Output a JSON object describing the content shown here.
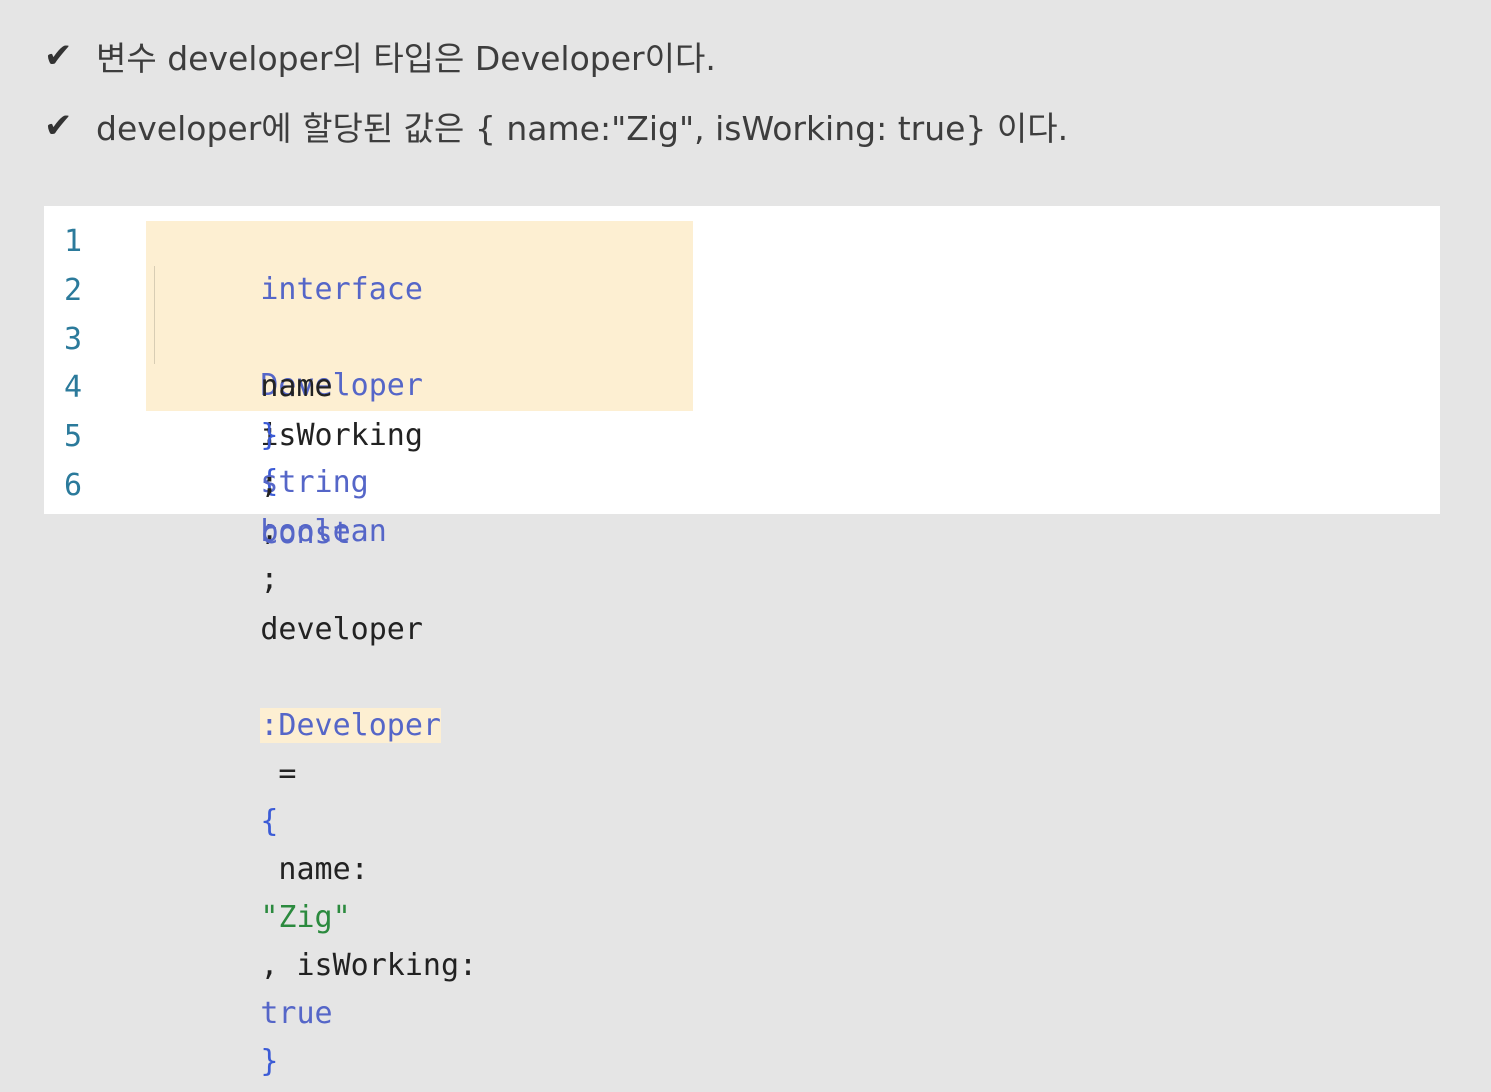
{
  "bullets": [
    {
      "check": "✔",
      "text": "변수 developer의 타입은 Developer이다."
    },
    {
      "check": "✔",
      "text": "developer에 할당된 값은 { name:\"Zig\", isWorking: true} 이다."
    }
  ],
  "code": {
    "line_numbers": [
      "1",
      "2",
      "3",
      "4",
      "5",
      "6"
    ],
    "line1": {
      "kw": "interface",
      "name": "Developer",
      "brace": "{"
    },
    "line2": {
      "indent": "    ",
      "prop": "name",
      "colon": ": ",
      "type": "string",
      "semi": ";"
    },
    "line3": {
      "indent": "    ",
      "prop": "isWorking",
      "colon": ": ",
      "type": "boolean",
      "semi": ";"
    },
    "line4": {
      "brace": "}",
      "semi": ";"
    },
    "line6": {
      "kw": "const",
      "var": "developer",
      "annotation": ":Developer",
      "eq": " = ",
      "open": "{",
      "k1": " name:",
      "v1": "\"Zig\"",
      "sep": ", isWorking: ",
      "v2": "true",
      "close": "}",
      "semi": ";"
    }
  },
  "colors": {
    "highlight": "#fdefd2",
    "keyword": "#5566c8",
    "string": "#2b8a3e",
    "line_number": "#2b7a9b"
  }
}
